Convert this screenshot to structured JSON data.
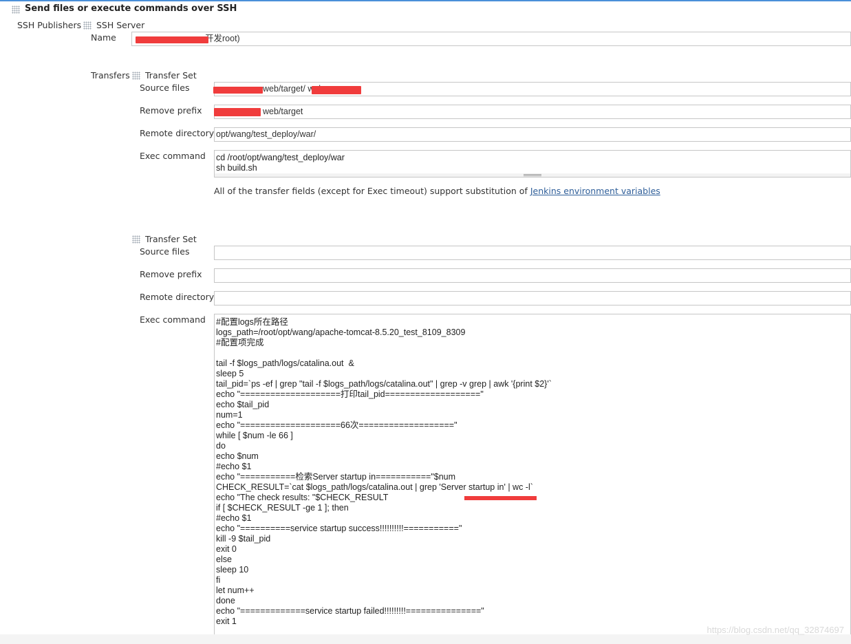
{
  "section": {
    "title": "Send files or execute commands over SSH"
  },
  "publishers": {
    "label": "SSH Publishers",
    "server_label": "SSH Server",
    "name_label": "Name",
    "name_value": "开发root)",
    "transfers_label": "Transfers"
  },
  "transfer_sets": [
    {
      "title": "Transfer Set",
      "source_label": "Source files",
      "source_value": "web/target/                    web.war",
      "prefix_label": "Remove prefix",
      "prefix_value": "web/target",
      "remote_label": "Remote directory",
      "remote_value": "opt/wang/test_deploy/war/",
      "exec_label": "Exec command",
      "exec_value": "cd /root/opt/wang/test_deploy/war\nsh build.sh"
    },
    {
      "title": "Transfer Set",
      "source_label": "Source files",
      "source_value": "",
      "prefix_label": "Remove prefix",
      "prefix_value": "",
      "remote_label": "Remote directory",
      "remote_value": "",
      "exec_label": "Exec command",
      "exec_value": "#配置logs所在路径\nlogs_path=/root/opt/wang/apache-tomcat-8.5.20_test_8109_8309\n#配置项完成\n\ntail -f $logs_path/logs/catalina.out  &\nsleep 5\ntail_pid=`ps -ef | grep \"tail -f $logs_path/logs/catalina.out\" | grep -v grep | awk '{print $2}'`\necho \"====================打印tail_pid===================\"\necho $tail_pid\nnum=1\necho \"====================66次===================\"\nwhile [ $num -le 66 ]\ndo\necho $num\n#echo $1\necho \"===========检索Server startup in===========\"$num\nCHECK_RESULT=`cat $logs_path/logs/catalina.out | grep 'Server startup in' | wc -l`\necho \"The check results: \"$CHECK_RESULT\nif [ $CHECK_RESULT -ge 1 ]; then\n#echo $1\necho \"==========service startup success!!!!!!!!!!===========\"\nkill -9 $tail_pid\nexit 0\nelse\nsleep 10\nfi\nlet num++\ndone\necho \"=============service startup failed!!!!!!!!!===============\"\nexit 1"
    }
  ],
  "hint": {
    "text": "All of the transfer fields (except for Exec timeout) support substitution of ",
    "link": "Jenkins environment variables"
  },
  "watermark": "https://blog.csdn.net/qq_32874697",
  "colors": {
    "accent": "#4a90d9",
    "link": "#2e5e99",
    "redaction": "#f03c3c"
  }
}
